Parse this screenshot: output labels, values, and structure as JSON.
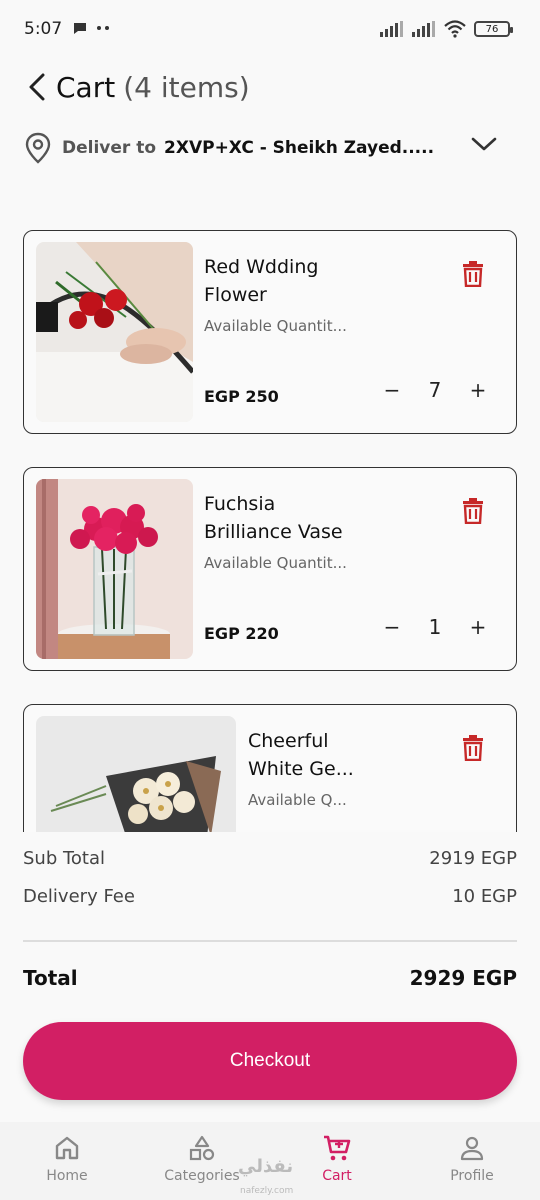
{
  "status_bar": {
    "time": "5:07",
    "battery": "76"
  },
  "header": {
    "title": "Cart",
    "count": "(4 items)"
  },
  "delivery": {
    "label": "Deliver to",
    "address": "2XVP+XC - Sheikh Zayed....."
  },
  "items": [
    {
      "name": "Red Wdding Flower",
      "availability": "Available Quantit...",
      "price": "EGP 250",
      "quantity": "7"
    },
    {
      "name": "Fuchsia Brilliance Vase",
      "availability": "Available Quantit...",
      "price": "EGP 220",
      "quantity": "1"
    },
    {
      "name": "Cheerful White Ge...",
      "availability": "Available Q...",
      "price": "",
      "quantity": ""
    }
  ],
  "summary": {
    "subtotal_label": "Sub Total",
    "subtotal_value": "2919 EGP",
    "delivery_label": "Delivery Fee",
    "delivery_value": "10 EGP",
    "total_label": "Total",
    "total_value": "2929 EGP"
  },
  "checkout_label": "Checkout",
  "nav": [
    {
      "label": "Home",
      "icon": "home-icon"
    },
    {
      "label": "Categories",
      "icon": "categories-icon"
    },
    {
      "label": "Cart",
      "icon": "cart-icon"
    },
    {
      "label": "Profile",
      "icon": "profile-icon"
    }
  ],
  "colors": {
    "accent": "#d21f64",
    "trash": "#c62828"
  },
  "watermark": {
    "text": "نفذلي",
    "sub": "nafezly.com"
  }
}
